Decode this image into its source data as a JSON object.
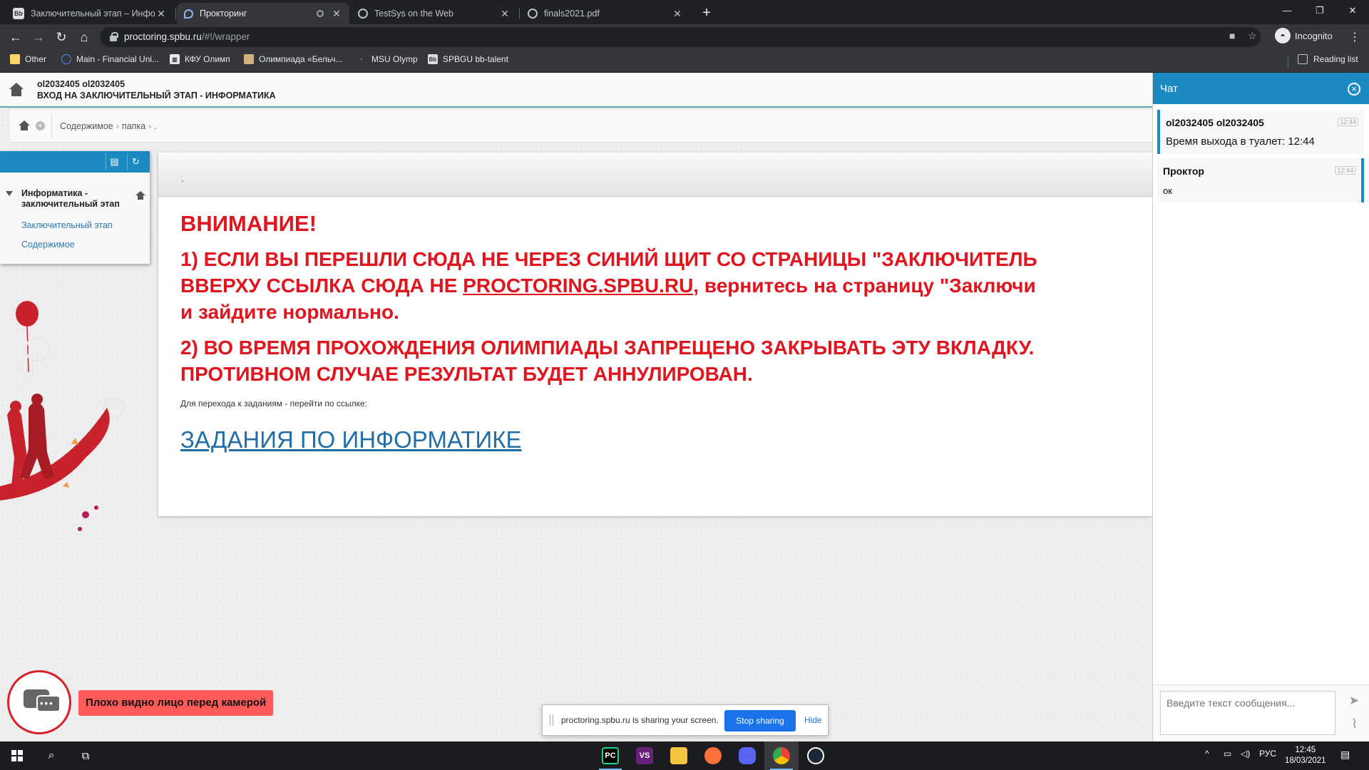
{
  "browser": {
    "tabs": [
      {
        "title": "Заключительный этап – Инфор",
        "favicon": "Bb",
        "active": false
      },
      {
        "title": "Прокторинг",
        "favicon": "proctoring-icon",
        "active": true
      },
      {
        "title": "TestSys on the Web",
        "favicon": "globe-icon",
        "active": false
      },
      {
        "title": "finals2021.pdf",
        "favicon": "globe-icon",
        "active": false
      }
    ],
    "url_host": "proctoring.spbu.ru",
    "url_path": "/#!/wrapper",
    "profile_label": "Incognito",
    "bookmarks": [
      {
        "label": "Other"
      },
      {
        "label": "Main - Financial Uni..."
      },
      {
        "label": "КФУ Олимп"
      },
      {
        "label": "Олимпиада «Бельч..."
      },
      {
        "label": "MSU Olymp"
      },
      {
        "label": "SPBGU bb-talent"
      }
    ],
    "reading_list": "Reading list"
  },
  "header": {
    "user": "ol2032405 ol2032405",
    "title": "ВХОД НА ЗАКЛЮЧИТЕЛЬНЫЙ ЭТАП - ИНФОРМАТИКА"
  },
  "breadcrumb": {
    "items": [
      "Содержимое",
      "папка",
      "."
    ]
  },
  "sidebar": {
    "root": "Информатика - заключительный этап",
    "links": [
      "Заключительный этап",
      "Содержимое"
    ]
  },
  "content": {
    "header_text": ".",
    "warning_title": "ВНИМАНИЕ!",
    "p1_line1": "1) ЕСЛИ ВЫ ПЕРЕШЛИ СЮДА НЕ ЧЕРЕЗ СИНИЙ ЩИТ СО СТРАНИЦЫ \"ЗАКЛЮЧИТЕЛЬ",
    "p1_line2a": "ВВЕРХУ ССЫЛКА СЮДА НЕ ",
    "p1_line2_link": "PROCTORING.SPBU.RU",
    "p1_line2b": ", вернитесь на страницу \"Заключи",
    "p1_line3": "и зайдите нормально.",
    "p2_line1": "2) ВО ВРЕМЯ ПРОХОЖДЕНИЯ ОЛИМПИАДЫ ЗАПРЕЩЕНО ЗАКРЫВАТЬ ЭТУ ВКЛАДКУ.",
    "p2_line2": "ПРОТИВНОМ СЛУЧАЕ РЕЗУЛЬТАТ БУДЕТ АННУЛИРОВАН.",
    "note": "Для перехода к заданиям - перейти по ссылке:",
    "tasks_link": "ЗАДАНИЯ ПО ИНФОРМАТИКЕ"
  },
  "sharing_bar": {
    "message": "proctoring.spbu.ru is sharing your screen.",
    "stop_label": "Stop sharing",
    "hide_label": "Hide"
  },
  "camera_warning": "Плохо видно лицо перед камерой",
  "chat": {
    "title": "Чат",
    "messages": [
      {
        "author": "ol2032405 ol2032405",
        "time": "12:44",
        "text": "Время выхода в туалет: 12:44"
      },
      {
        "author": "Проктор",
        "time": "12:44",
        "text": "ок"
      }
    ],
    "input_placeholder": "Введите текст сообщения..."
  },
  "taskbar": {
    "language": "РУС",
    "time": "12:45",
    "date": "18/03/2021"
  },
  "colors": {
    "accent": "#1a8ac0",
    "warning_red": "#e0151e",
    "link_blue": "#1f6ea8"
  }
}
